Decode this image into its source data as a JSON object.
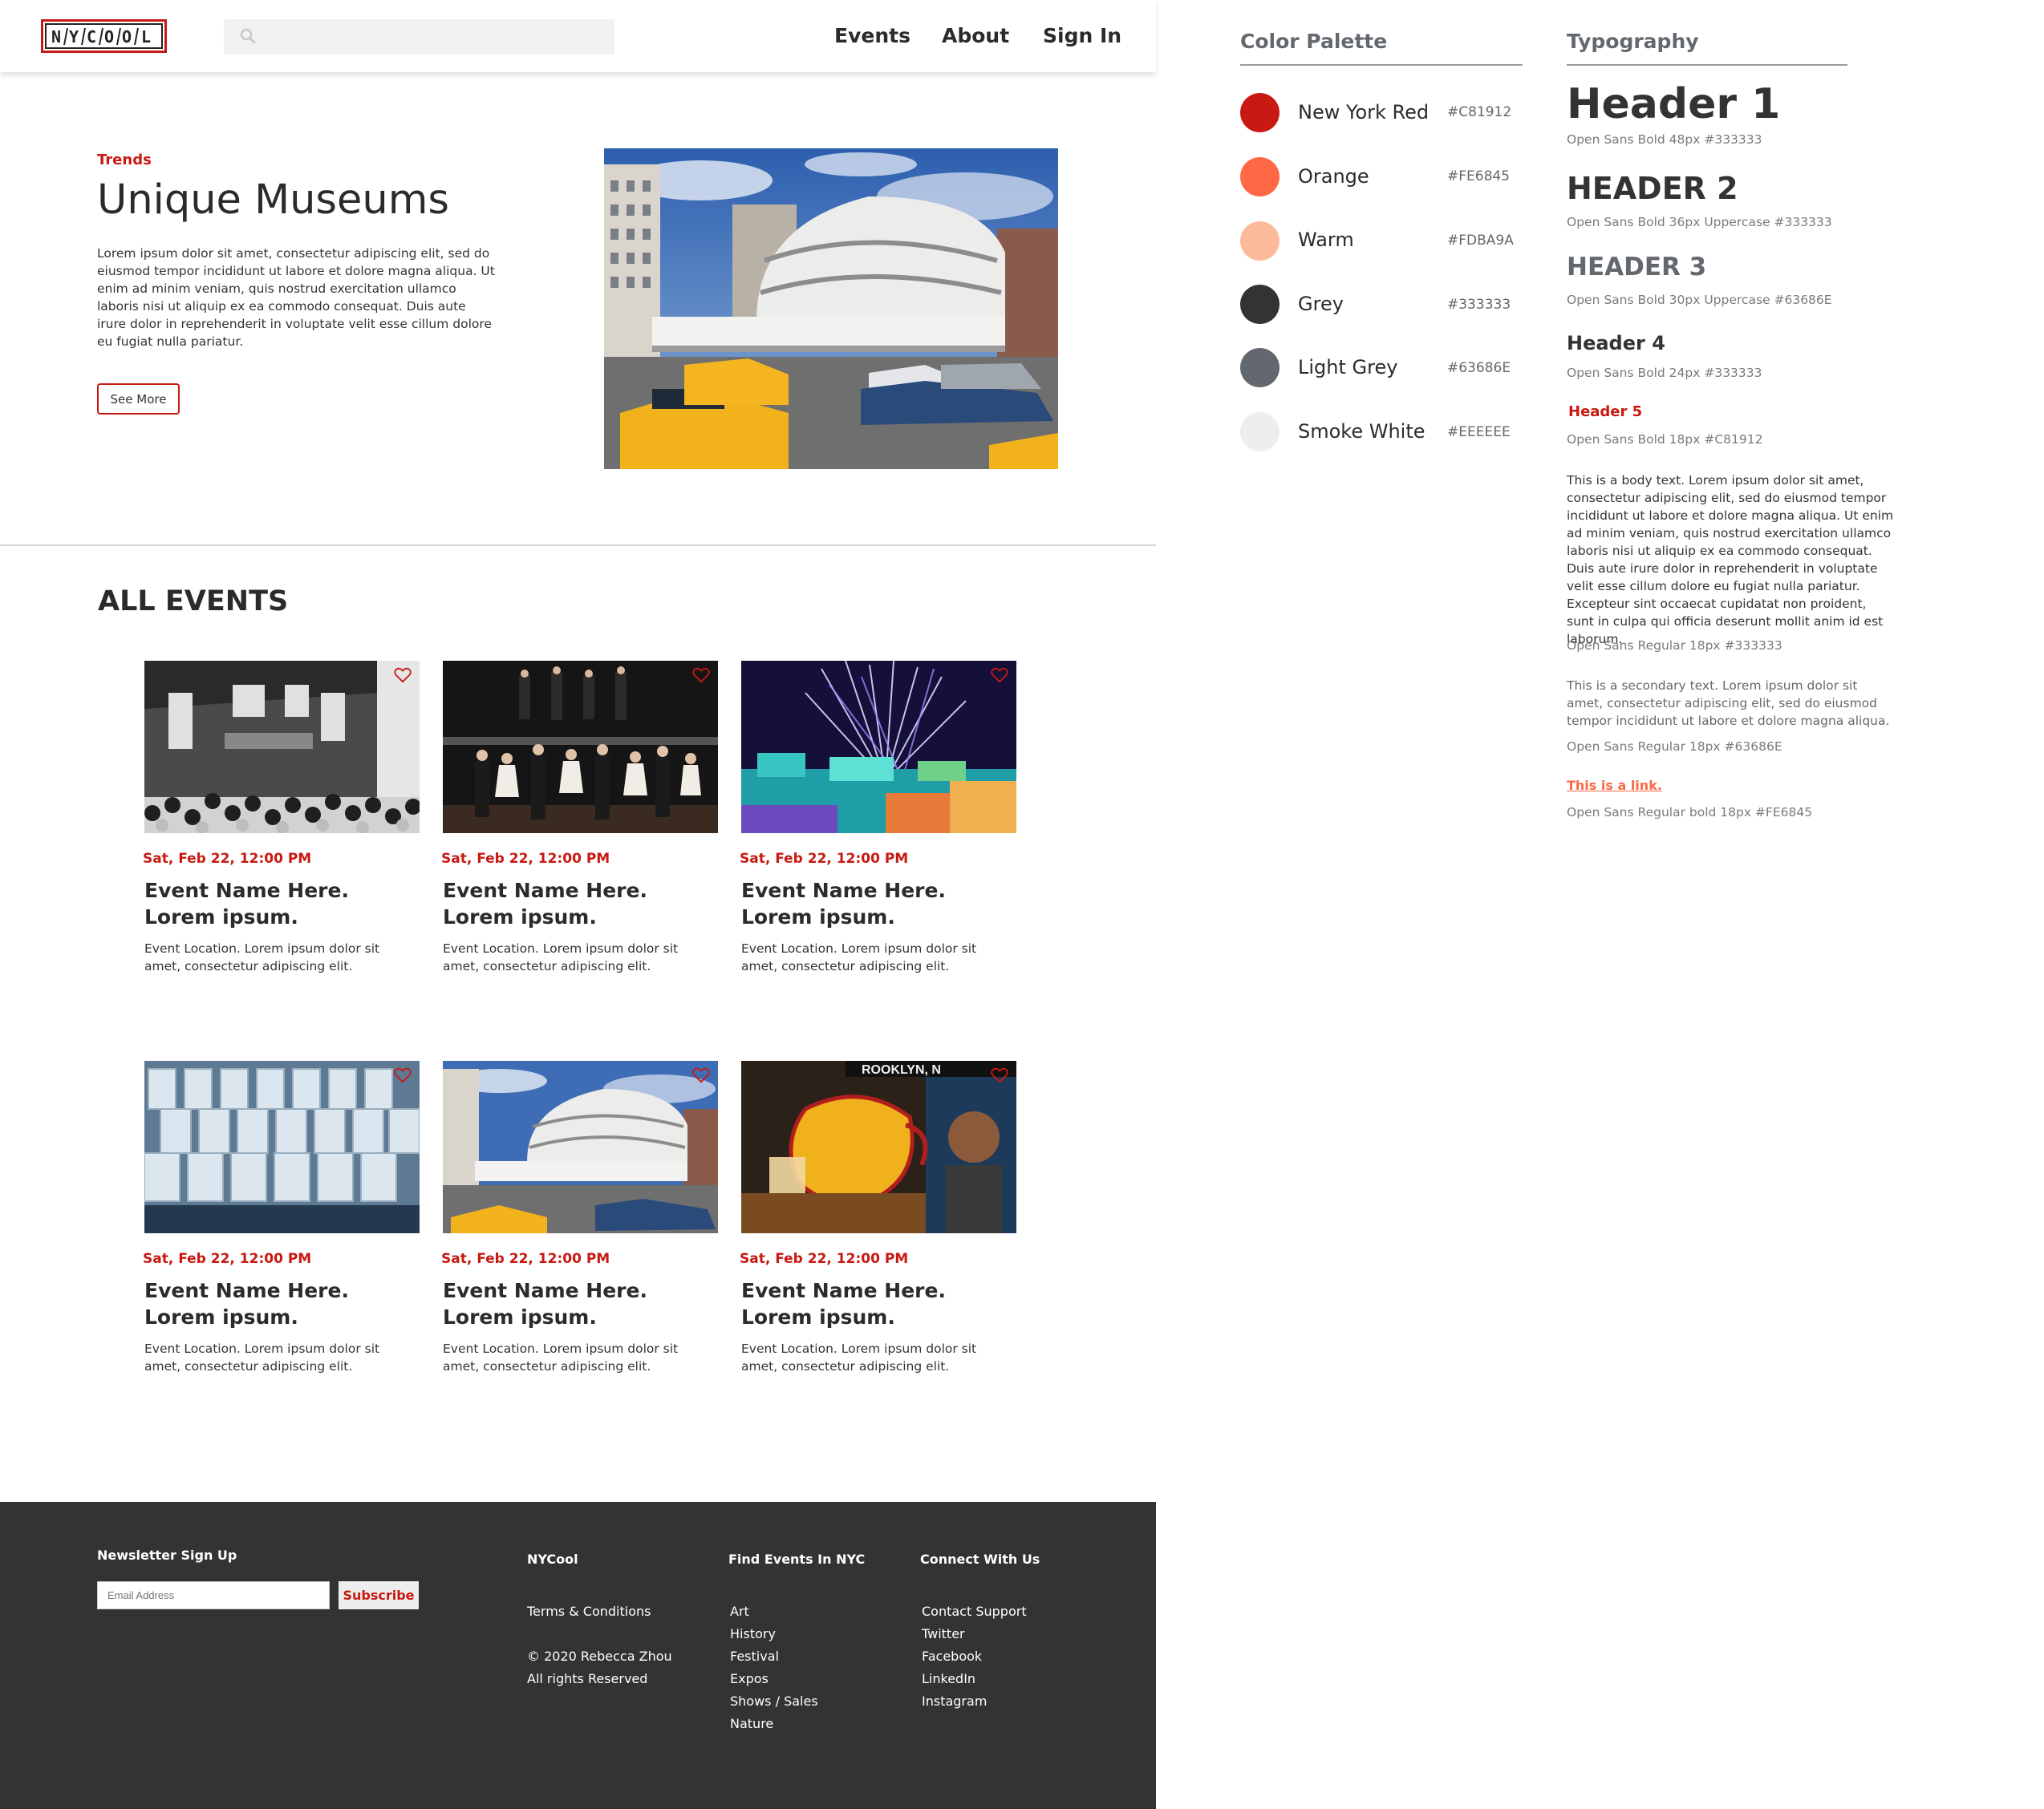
{
  "header": {
    "logo_text": "NYCOOL",
    "nav": [
      "Events",
      "About",
      "Sign In"
    ]
  },
  "hero": {
    "kicker": "Trends",
    "title": "Unique Museums",
    "body": "Lorem ipsum dolor sit amet, consectetur adipiscing elit, sed do eiusmod tempor incididunt ut labore et dolore magna aliqua. Ut enim ad minim veniam, quis nostrud exercitation ullamco laboris nisi ut aliquip ex ea commodo consequat. Duis aute irure dolor in reprehenderit in voluptate velit esse cillum dolore eu fugiat nulla pariatur.",
    "button": "See More"
  },
  "events": {
    "heading": "ALL EVENTS",
    "cards": [
      {
        "date": "Sat, Feb 22, 12:00 PM",
        "name": "Event Name Here. Lorem ipsum.",
        "location": "Event Location. Lorem ipsum dolor sit amet, consectetur adipiscing elit.",
        "image": "historic-crowd-photo"
      },
      {
        "date": "Sat, Feb 22, 12:00 PM",
        "name": "Event Name Here. Lorem ipsum.",
        "location": "Event Location. Lorem ipsum dolor sit amet, consectetur adipiscing elit.",
        "image": "stage-performers-photo"
      },
      {
        "date": "Sat, Feb 22, 12:00 PM",
        "name": "Event Name Here. Lorem ipsum.",
        "location": "Event Location. Lorem ipsum dolor sit amet, consectetur adipiscing elit.",
        "image": "fireworks-ice-castle-photo"
      },
      {
        "date": "Sat, Feb 22, 12:00 PM",
        "name": "Event Name Here. Lorem ipsum.",
        "location": "Event Location. Lorem ipsum dolor sit amet, consectetur adipiscing elit.",
        "image": "tasting-glasses-photo"
      },
      {
        "date": "Sat, Feb 22, 12:00 PM",
        "name": "Event Name Here. Lorem ipsum.",
        "location": "Event Location. Lorem ipsum dolor sit amet, consectetur adipiscing elit.",
        "image": "guggenheim-photo"
      },
      {
        "date": "Sat, Feb 22, 12:00 PM",
        "name": "Event Name Here. Lorem ipsum.",
        "location": "Event Location. Lorem ipsum dolor sit amet, consectetur adipiscing elit.",
        "image": "coffee-tea-festival-photo"
      }
    ]
  },
  "footer": {
    "newsletter_title": "Newsletter Sign Up",
    "email_placeholder": "Email Address",
    "subscribe": "Subscribe",
    "col1": {
      "title": "NYCool",
      "items": [
        "Terms & Conditions",
        "© 2020 Rebecca Zhou",
        "All rights Reserved"
      ]
    },
    "col2": {
      "title": "Find Events In NYC",
      "items": [
        "Art",
        "History",
        "Festival",
        "Expos",
        "Shows / Sales",
        "Nature"
      ]
    },
    "col3": {
      "title": "Connect With Us",
      "items": [
        "Contact Support",
        "Twitter",
        "Facebook",
        "LinkedIn",
        "Instagram"
      ]
    }
  },
  "palette": {
    "title": "Color Palette",
    "colors": [
      {
        "name": "New York Red",
        "hex": "#C81912"
      },
      {
        "name": "Orange",
        "hex": "#FE6845"
      },
      {
        "name": "Warm",
        "hex": "#FDBA9A"
      },
      {
        "name": "Grey",
        "hex": "#333333"
      },
      {
        "name": "Light Grey",
        "hex": "#63686E"
      },
      {
        "name": "Smoke White",
        "hex": "#EEEEEE"
      }
    ]
  },
  "typography": {
    "title": "Typography",
    "h1": "Header 1",
    "h1_caption": "Open Sans Bold 48px #333333",
    "h2": "Header 2",
    "h2_caption": "Open Sans Bold 36px Uppercase #333333",
    "h3": "Header 3",
    "h3_caption": "Open Sans Bold 30px Uppercase #63686E",
    "h4": "Header 4",
    "h4_caption": "Open Sans Bold 24px #333333",
    "h5": "Header 5",
    "h5_caption": "Open Sans Bold 18px #C81912",
    "body": "This is a body text. Lorem ipsum dolor sit amet, consectetur adipiscing elit, sed do eiusmod tempor incididunt ut labore et dolore magna aliqua. Ut enim ad minim veniam, quis nostrud exercitation ullamco laboris nisi ut aliquip ex ea commodo consequat. Duis aute irure dolor in reprehenderit in voluptate velit esse cillum dolore eu fugiat nulla pariatur. Excepteur sint occaecat cupidatat non proident, sunt in culpa qui officia deserunt mollit anim id est laborum.",
    "body_caption": "Open Sans Regular 18px #333333",
    "secondary": "This is a secondary text. Lorem ipsum dolor sit amet, consectetur adipiscing elit, sed do eiusmod tempor incididunt ut labore et dolore magna aliqua.",
    "secondary_caption": "Open Sans Regular 18px #63686E",
    "link": "This is a link.",
    "link_caption": "Open Sans Regular bold 18px #FE6845"
  }
}
